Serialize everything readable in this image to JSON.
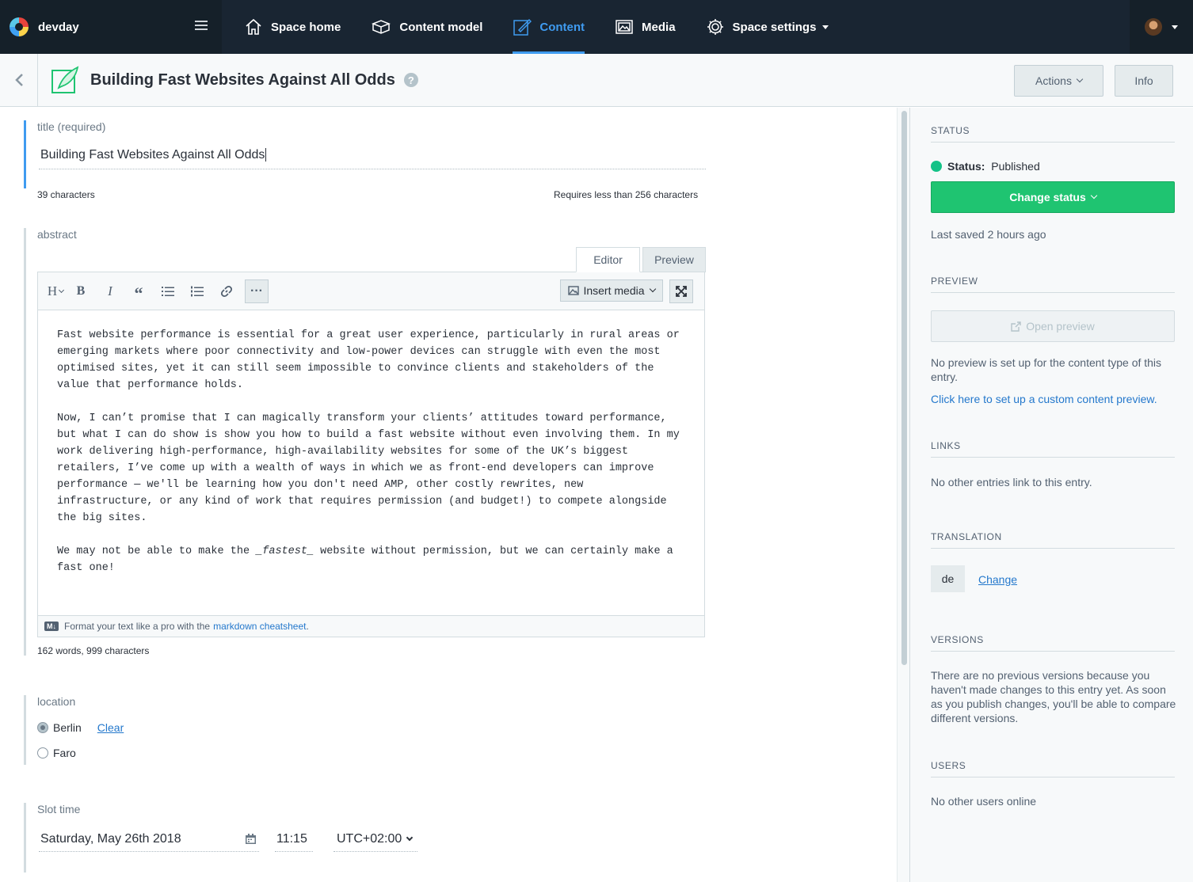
{
  "nav": {
    "space_name": "devday",
    "items": [
      {
        "label": "Space home",
        "icon": "home-icon"
      },
      {
        "label": "Content model",
        "icon": "content-model-icon"
      },
      {
        "label": "Content",
        "icon": "content-icon"
      },
      {
        "label": "Media",
        "icon": "media-icon"
      },
      {
        "label": "Space settings",
        "icon": "gear-icon"
      }
    ],
    "active_item": "Content"
  },
  "entry": {
    "title": "Building Fast Websites Against All Odds",
    "actions_label": "Actions",
    "info_label": "Info"
  },
  "fields": {
    "title": {
      "label": "title (required)",
      "value": "Building Fast Websites Against All Odds",
      "char_count": "39 characters",
      "limit": "Requires less than 256 characters"
    },
    "abstract": {
      "label": "abstract",
      "tab_editor": "Editor",
      "tab_preview": "Preview",
      "insert_media": "Insert media",
      "paragraphs": [
        "Fast website performance is essential for a great user experience, particularly in rural areas or emerging markets where poor connectivity and low-power devices can struggle with even the most optimised sites, yet it can still seem impossible to convince clients and stakeholders of the value that performance holds.",
        "Now, I can’t promise that I can magically transform your clients’ attitudes toward performance, but what I can do show is show you how to build a fast website without even involving them. In my work delivering high-performance, high-availability websites for some of the UK’s biggest retailers, I’ve come up with a wealth of ways in which we as front-end developers can improve performance — we'll be learning how you don't need AMP, other costly rewrites, new infrastructure, or any kind of work that requires permission (and budget!) to compete alongside the big sites."
      ],
      "p3_before": "We may not be able to make the ",
      "p3_em": "_fastest_",
      "p3_after": " website without permission, but we can certainly make a fast one!",
      "footer_text": "Format your text like a pro with the ",
      "footer_link": "markdown cheatsheet",
      "footer_end": ".",
      "md_badge": "M↓",
      "word_count": "162 words, 999 characters"
    },
    "location": {
      "label": "location",
      "options": [
        "Berlin",
        "Faro"
      ],
      "selected": "Berlin",
      "clear_label": "Clear"
    },
    "slot_time": {
      "label": "Slot time",
      "date": "Saturday, May 26th 2018",
      "time": "11:15",
      "timezone": "UTC+02:00"
    }
  },
  "sidebar": {
    "status": {
      "heading": "STATUS",
      "label": "Status:",
      "value": "Published",
      "change_button": "Change status",
      "last_saved": "Last saved 2 hours ago"
    },
    "preview": {
      "heading": "PREVIEW",
      "button": "Open preview",
      "note": "No preview is set up for the content type of this entry.",
      "link": "Click here to set up a custom content preview."
    },
    "links": {
      "heading": "LINKS",
      "text": "No other entries link to this entry."
    },
    "translation": {
      "heading": "TRANSLATION",
      "locale": "de",
      "change_label": "Change"
    },
    "versions": {
      "heading": "VERSIONS",
      "text": "There are no previous versions because you haven't made changes to this entry yet. As soon as you publish changes, you'll be able to compare different versions."
    },
    "users": {
      "heading": "USERS",
      "text": "No other users online"
    }
  },
  "colors": {
    "nav_bg": "#192532",
    "accent": "#3f9bf0",
    "published": "#14c287",
    "change_status": "#1fc471"
  }
}
